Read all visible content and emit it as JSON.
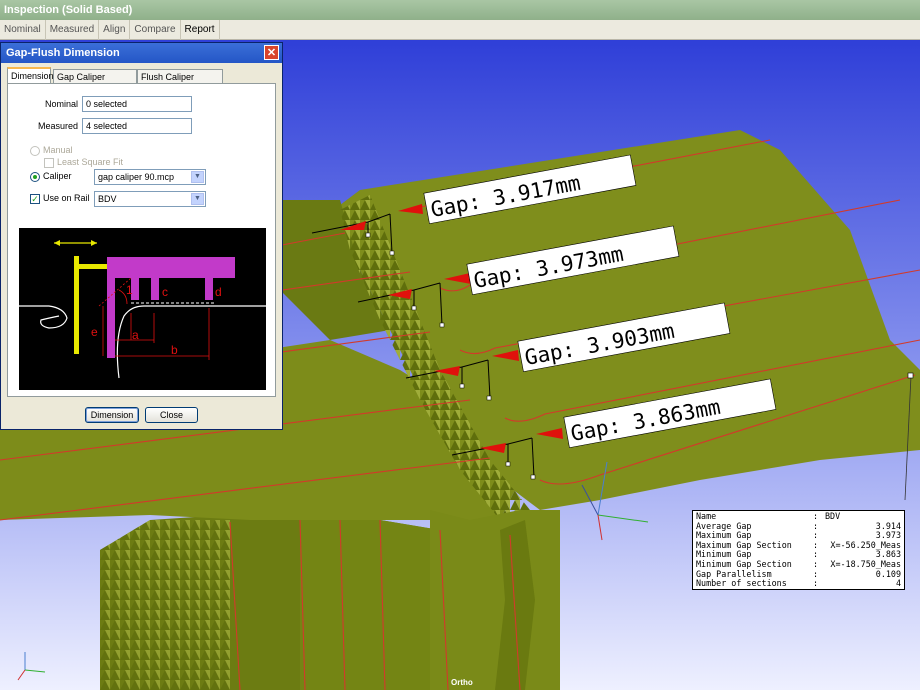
{
  "app": {
    "title": "Inspection (Solid Based)"
  },
  "menu": [
    "Nominal",
    "Measured",
    "Align",
    "Compare",
    "Report"
  ],
  "viewport": {
    "gap_labels": [
      "Gap: 3.917mm",
      "Gap: 3.973mm",
      "Gap: 3.903mm",
      "Gap: 3.863mm"
    ],
    "projection": "Ortho",
    "colors": {
      "sky_top": "#2f3fd8",
      "sky_bottom": "#eef0ff",
      "surface": "#7a8a17",
      "rail": "#d23a2a",
      "arrow": "#e0100c"
    }
  },
  "dialog": {
    "title": "Gap-Flush Dimension",
    "close_glyph": "✕",
    "tabs": [
      "Dimension",
      "Gap Caliper Definition",
      "Flush Caliper Definition"
    ],
    "nominal_label": "Nominal",
    "nominal_value": "0 selected",
    "measured_label": "Measured",
    "measured_value": "4 selected",
    "manual_label": "Manual",
    "least_square_label": "Least Square Fit",
    "caliper_label": "Caliper",
    "caliper_value": "gap caliper 90.mcp",
    "use_on_rail_label": "Use on Rail",
    "rail_value": "BDV",
    "diagram_letters": [
      "1",
      "c",
      "d",
      "e",
      "a",
      "b"
    ],
    "dimension_button": "Dimension",
    "close_button": "Close"
  },
  "info": {
    "rows": [
      {
        "key": "Name",
        "sep": ":",
        "value": "BDV"
      },
      {
        "key": "Average Gap",
        "sep": ":",
        "value": "3.914"
      },
      {
        "key": "Maximum Gap",
        "sep": ":",
        "value": "3.973"
      },
      {
        "key": "Maximum Gap Section",
        "sep": ":",
        "value": "X=-56.250_Meas"
      },
      {
        "key": "Minimum Gap",
        "sep": ":",
        "value": "3.863"
      },
      {
        "key": "Minimum Gap Section",
        "sep": ":",
        "value": "X=-18.750_Meas"
      },
      {
        "key": "Gap Parallelism",
        "sep": ":",
        "value": "0.109"
      },
      {
        "key": "Number of sections",
        "sep": ":",
        "value": "4"
      }
    ]
  }
}
